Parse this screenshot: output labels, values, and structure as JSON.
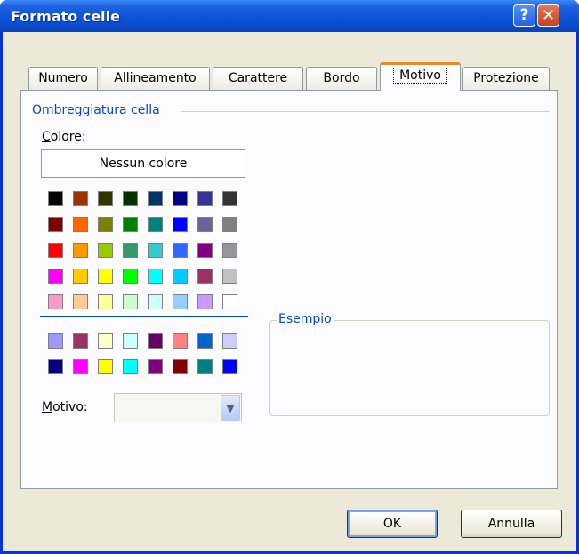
{
  "window": {
    "title": "Formato celle",
    "help_label": "?",
    "close_label": "✕"
  },
  "tabs": [
    "Numero",
    "Allineamento",
    "Carattere",
    "Bordo",
    "Motivo",
    "Protezione"
  ],
  "active_tab": "Motivo",
  "shading": {
    "group_title": "Ombreggiatura cella",
    "color_label_u": "C",
    "color_label_rest": "olore:",
    "no_color_label": "Nessun colore",
    "pattern_label_u": "M",
    "pattern_label_rest": "otivo:",
    "pattern_value": "",
    "palette_main": [
      [
        "#000000",
        "#993300",
        "#333300",
        "#003300",
        "#003366",
        "#000080",
        "#333399",
        "#333333"
      ],
      [
        "#800000",
        "#FF6600",
        "#808000",
        "#008000",
        "#008080",
        "#0000FF",
        "#666699",
        "#808080"
      ],
      [
        "#FF0000",
        "#FF9900",
        "#99CC00",
        "#339966",
        "#33CCCC",
        "#3366FF",
        "#800080",
        "#969696"
      ],
      [
        "#FF00FF",
        "#FFCC00",
        "#FFFF00",
        "#00FF00",
        "#00FFFF",
        "#00CCFF",
        "#993366",
        "#C0C0C0"
      ],
      [
        "#FF99CC",
        "#FFCC99",
        "#FFFF99",
        "#CCFFCC",
        "#CCFFFF",
        "#99CCFF",
        "#CC99FF",
        "#FFFFFF"
      ]
    ],
    "palette_chart": [
      [
        "#9999FF",
        "#993366",
        "#FFFFCC",
        "#CCFFFF",
        "#660066",
        "#FF8080",
        "#0066CC",
        "#CCCCFF"
      ],
      [
        "#000080",
        "#FF00FF",
        "#FFFF00",
        "#00FFFF",
        "#800080",
        "#800000",
        "#008080",
        "#0000FF"
      ]
    ]
  },
  "sample": {
    "title": "Esempio"
  },
  "buttons": {
    "ok": "OK",
    "cancel": "Annulla"
  },
  "colors": {
    "accent": "#0046d5",
    "titlebar": "#0a4bcc",
    "tab_highlight": "#e68b2c",
    "dialog_bg": "#ece9d8"
  }
}
